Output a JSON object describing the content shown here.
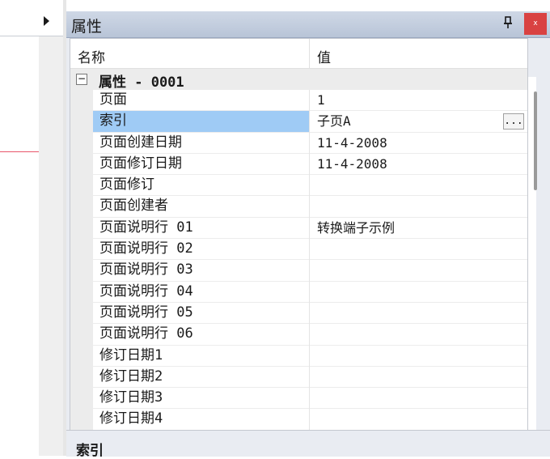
{
  "panel": {
    "title": "属性",
    "pin_icon": "pin-icon",
    "close_label": "x"
  },
  "grid": {
    "header": {
      "name": "名称",
      "value": "值"
    },
    "category": {
      "toggle": "−",
      "label": "属性 - 0001"
    },
    "rows": [
      {
        "name": "页面",
        "value": "1"
      },
      {
        "name": "索引",
        "value": "子页A",
        "selected": true,
        "button": "..."
      },
      {
        "name": "页面创建日期",
        "value": "11-4-2008"
      },
      {
        "name": "页面修订日期",
        "value": "11-4-2008"
      },
      {
        "name": "页面修订",
        "value": ""
      },
      {
        "name": "页面创建者",
        "value": ""
      },
      {
        "name": "页面说明行 01",
        "value": "转换端子示例"
      },
      {
        "name": "页面说明行 02",
        "value": ""
      },
      {
        "name": "页面说明行 03",
        "value": ""
      },
      {
        "name": "页面说明行 04",
        "value": ""
      },
      {
        "name": "页面说明行 05",
        "value": ""
      },
      {
        "name": "页面说明行 06",
        "value": ""
      },
      {
        "name": "修订日期1",
        "value": ""
      },
      {
        "name": "修订日期2",
        "value": ""
      },
      {
        "name": "修订日期3",
        "value": ""
      },
      {
        "name": "修订日期4",
        "value": ""
      }
    ]
  },
  "description": {
    "title": "索引"
  },
  "colors": {
    "selected_row": "#9fcbf5",
    "close_button": "#d94242",
    "title_bar": "#c4cede"
  }
}
